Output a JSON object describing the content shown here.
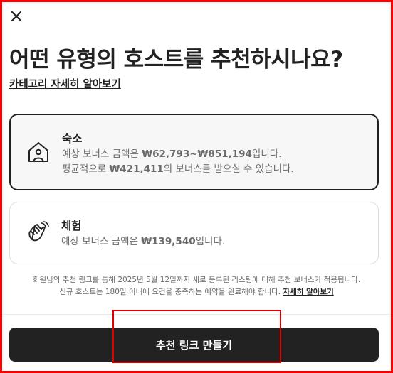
{
  "modal": {
    "title": "어떤 유형의 호스트를 추천하시나요?",
    "category_link": "카테고리 자세히 알아보기"
  },
  "options": [
    {
      "title": "숙소",
      "icon": "home-icon",
      "selected": true,
      "line1_prefix": "예상 보너스 금액은 ",
      "line1_amount": "₩62,793~₩851,194",
      "line1_suffix": "입니다.",
      "line2_prefix": "평균적으로 ",
      "line2_amount": "₩421,411",
      "line2_suffix": "의 보너스를 받으실 수 있습니다."
    },
    {
      "title": "체험",
      "icon": "waving-hand-icon",
      "selected": false,
      "line1_prefix": "예상 보너스 금액은 ",
      "line1_amount": "₩139,540",
      "line1_suffix": "입니다."
    }
  ],
  "notice": {
    "line1": "회원님의 추천 링크를 통해 2025년 5월 12일까지 새로 등록된 리스팅에 대해 추천 보너스가 적용됩니다.",
    "line2": "신규 호스트는 180일 이내에 요건을 충족하는 예약을 완료해야 합니다. ",
    "link": "자세히 알아보기"
  },
  "cta": {
    "label": "추천 링크 만들기"
  },
  "colors": {
    "primary": "#222222",
    "highlight": "#e00000",
    "muted": "#6a6a6a"
  }
}
